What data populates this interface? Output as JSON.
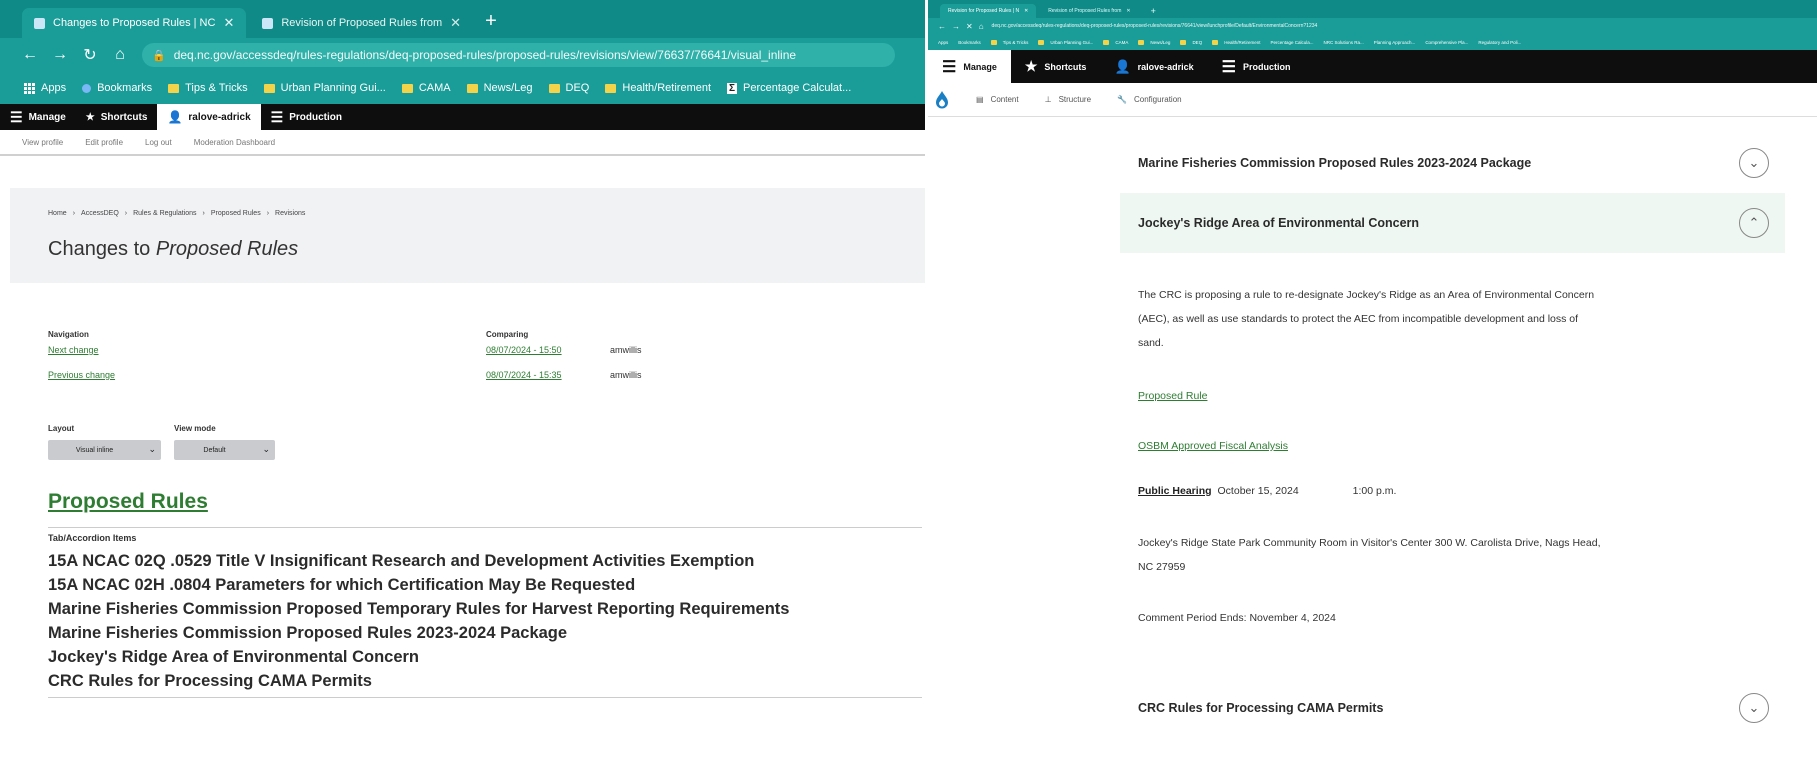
{
  "left": {
    "tabs": [
      {
        "label": "Changes to Proposed Rules | NC",
        "active": true
      },
      {
        "label": "Revision of Proposed Rules from",
        "active": false
      }
    ],
    "url": "deq.nc.gov/accessdeq/rules-regulations/deq-proposed-rules/proposed-rules/revisions/view/76637/76641/visual_inline",
    "bookmarks": [
      "Apps",
      "Bookmarks",
      "Tips & Tricks",
      "Urban Planning Gui...",
      "CAMA",
      "News/Leg",
      "DEQ",
      "Health/Retirement",
      "Percentage Calculat..."
    ],
    "toolbar": {
      "manage": "Manage",
      "shortcuts": "Shortcuts",
      "user": "ralove-adrick",
      "production": "Production"
    },
    "user_links": [
      "View profile",
      "Edit profile",
      "Log out",
      "Moderation Dashboard"
    ],
    "breadcrumb": [
      "Home",
      "AccessDEQ",
      "Rules & Regulations",
      "Proposed Rules",
      "Revisions"
    ],
    "page_title_prefix": "Changes to",
    "page_title_em": "Proposed Rules",
    "navigation": {
      "label": "Navigation",
      "next": "Next change",
      "previous": "Previous change"
    },
    "comparing": {
      "label": "Comparing",
      "rows": [
        {
          "date": "08/07/2024 - 15:50",
          "user": "amwillis"
        },
        {
          "date": "08/07/2024 - 15:35",
          "user": "amwillis"
        }
      ]
    },
    "layout": {
      "label": "Layout",
      "value": "Visual inline"
    },
    "view_mode": {
      "label": "View mode",
      "value": "Default"
    },
    "section_title": "Proposed Rules",
    "accordion_label": "Tab/Accordion Items",
    "accordion_items": [
      "15A NCAC 02Q .0529 Title V Insignificant Research and Development Activities Exemption",
      "15A NCAC 02H .0804 Parameters for which Certification May Be Requested",
      "Marine Fisheries Commission Proposed Temporary Rules for Harvest Reporting Requirements",
      "Marine Fisheries Commission Proposed Rules 2023-2024 Package",
      "Jockey's Ridge Area of Environmental Concern",
      "CRC Rules for Processing CAMA Permits"
    ]
  },
  "right": {
    "tabs": [
      "Revision for Proposed Rules | N",
      "Revision of Proposed Rules from"
    ],
    "url": "deq.nc.gov/accessdeq/rules-regulations/deq-proposed-rules/proposed-rules/revisions/76641/view/lunchprofile/Default/EnvironmentalConcern?1234",
    "bookmarks": [
      "Apps",
      "Bookmarks",
      "Tips & Tricks",
      "Urban Planning Gui...",
      "CAMA",
      "News/Leg",
      "DEQ",
      "Health/Retirement",
      "Percentage Calcula...",
      "NRC Solutions Ra...",
      "Planning Approach...",
      "Comprehensive Pla...",
      "Regulatory and Poli..."
    ],
    "toolbar": {
      "manage": "Manage",
      "shortcuts": "Shortcuts",
      "user": "ralove-adrick",
      "production": "Production"
    },
    "tray": {
      "content": "Content",
      "structure": "Structure",
      "configuration": "Configuration"
    },
    "accordion": {
      "marine": "Marine Fisheries Commission Proposed Rules 2023-2024 Package",
      "jockey": "Jockey's Ridge Area of Environmental Concern",
      "crc": "CRC Rules for Processing CAMA Permits"
    },
    "description_1": "The CRC is proposing a rule to re-designate Jockey's Ridge as an Area of Environmental Concern",
    "description_2": "(AEC), as well as use standards to protect the AEC from incompatible development and loss of",
    "description_3": "sand.",
    "proposed_rule_link": "Proposed Rule",
    "osbm_link": "OSBM Approved Fiscal Analysis",
    "public_hearing": {
      "label": "Public Hearing",
      "date": "October 15, 2024",
      "time": "1:00 p.m."
    },
    "location_1": "Jockey's Ridge State Park Community Room in Visitor's Center 300 W. Carolista Drive, Nags Head,",
    "location_2": "NC 27959",
    "comment_period": "Comment Period Ends: November 4, 2024"
  }
}
